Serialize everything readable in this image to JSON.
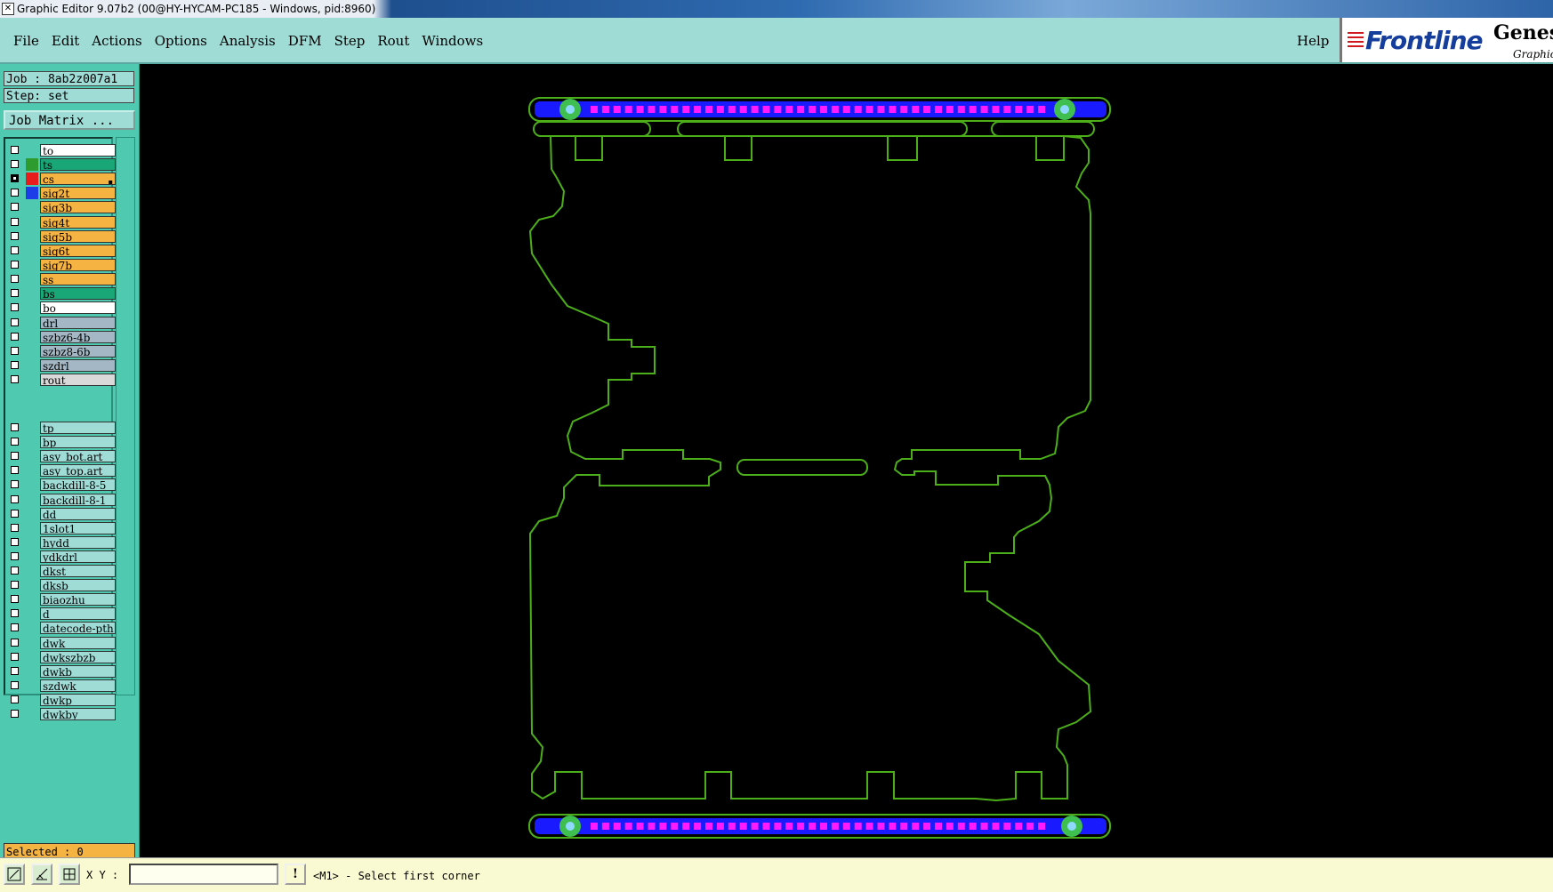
{
  "window": {
    "title": "Graphic Editor 9.07b2 (00@HY-HYCAM-PC185 - Windows, pid:8960)"
  },
  "menu": {
    "items": [
      "File",
      "Edit",
      "Actions",
      "Options",
      "Analysis",
      "DFM",
      "Step",
      "Rout",
      "Windows"
    ],
    "help": "Help"
  },
  "logo": {
    "brand": "Frontline",
    "product": "Genesis",
    "sub": "Graphic"
  },
  "job": {
    "job_label": "Job : 8ab2z007a1",
    "step_label": "Step: set",
    "matrix_button": "Job Matrix ..."
  },
  "layers": {
    "group1": [
      {
        "name": "to",
        "color": "#ffffff",
        "swatch": null,
        "checked": false
      },
      {
        "name": "ts",
        "color": "#1aa777",
        "swatch": "#2e9b2e",
        "checked": false
      },
      {
        "name": "cs",
        "color": "#f5b342",
        "swatch": "#e81c1c",
        "checked": true,
        "active": true
      },
      {
        "name": "sig2t",
        "color": "#f5b342",
        "swatch": "#1c3de8",
        "checked": false
      },
      {
        "name": "sig3b",
        "color": "#f5b342",
        "swatch": null,
        "checked": false
      },
      {
        "name": "sig4t",
        "color": "#f5b342",
        "swatch": null,
        "checked": false
      },
      {
        "name": "sig5b",
        "color": "#f5b342",
        "swatch": null,
        "checked": false
      },
      {
        "name": "sig6t",
        "color": "#f5b342",
        "swatch": null,
        "checked": false
      },
      {
        "name": "sig7b",
        "color": "#f5b342",
        "swatch": null,
        "checked": false
      },
      {
        "name": "ss",
        "color": "#f5b342",
        "swatch": null,
        "checked": false
      },
      {
        "name": "bs",
        "color": "#1aa777",
        "swatch": null,
        "checked": false
      },
      {
        "name": "bo",
        "color": "#ffffff",
        "swatch": null,
        "checked": false
      }
    ],
    "group2": [
      {
        "name": "drl",
        "color": "#a3b8c4",
        "checked": false
      },
      {
        "name": "szbz6-4b",
        "color": "#a3b8c4",
        "checked": false
      },
      {
        "name": "szbz8-6b",
        "color": "#a3b8c4",
        "checked": false
      },
      {
        "name": "szdrl",
        "color": "#a3b8c4",
        "checked": false
      },
      {
        "name": "rout",
        "color": "#d9d9d9",
        "checked": false
      }
    ],
    "group3": [
      {
        "name": "tp",
        "color": "#9fdcd6",
        "checked": false
      },
      {
        "name": "bp",
        "color": "#9fdcd6",
        "checked": false
      },
      {
        "name": "asy_bot.art",
        "color": "#9fdcd6",
        "checked": false
      },
      {
        "name": "asy_top.art",
        "color": "#9fdcd6",
        "checked": false
      },
      {
        "name": "backdill-8-5",
        "color": "#9fdcd6",
        "checked": false
      },
      {
        "name": "backdill-8-1",
        "color": "#9fdcd6",
        "checked": false
      },
      {
        "name": "dd",
        "color": "#9fdcd6",
        "checked": false
      },
      {
        "name": "1slot1",
        "color": "#9fdcd6",
        "checked": false
      },
      {
        "name": "hydd",
        "color": "#9fdcd6",
        "checked": false
      },
      {
        "name": "ydkdrl",
        "color": "#9fdcd6",
        "checked": false
      },
      {
        "name": "dkst",
        "color": "#9fdcd6",
        "checked": false
      },
      {
        "name": "dksb",
        "color": "#9fdcd6",
        "checked": false
      },
      {
        "name": "biaozhu",
        "color": "#9fdcd6",
        "checked": false
      },
      {
        "name": "d",
        "color": "#9fdcd6",
        "checked": false
      },
      {
        "name": "datecode-pth",
        "color": "#9fdcd6",
        "checked": false
      },
      {
        "name": "dwk",
        "color": "#9fdcd6",
        "checked": false
      },
      {
        "name": "dwkszbzb",
        "color": "#9fdcd6",
        "checked": false
      },
      {
        "name": "dwkb",
        "color": "#9fdcd6",
        "checked": false
      },
      {
        "name": "szdwk",
        "color": "#9fdcd6",
        "checked": false
      },
      {
        "name": "dwkp",
        "color": "#9fdcd6",
        "checked": false
      },
      {
        "name": "dwkby",
        "color": "#9fdcd6",
        "checked": false
      }
    ]
  },
  "status": {
    "selected": "Selected : 0",
    "xy_label": "X Y :",
    "xy_value": "",
    "exclaim": "!",
    "prompt": "<M1> - Select first corner"
  },
  "colors": {
    "outline": "#4caf1a",
    "strip": "#1a1aff",
    "pad": "#ff1aff",
    "fiducial": "#3fbf4f",
    "fiducial_center": "#8fd8ff"
  }
}
